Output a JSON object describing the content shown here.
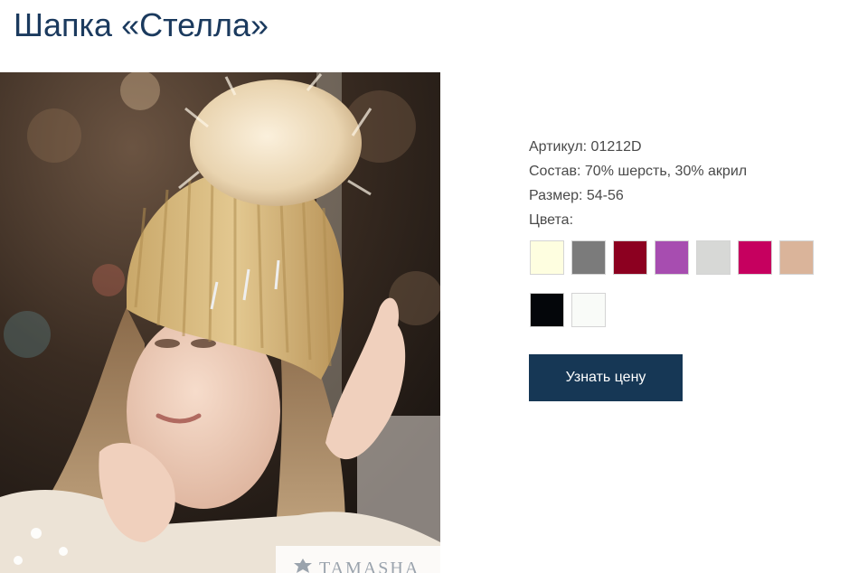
{
  "product": {
    "title": "Шапка «Стелла»",
    "article": "Артикул: 01212D",
    "composition": "Состав: 70% шерсть, 30% акрил",
    "size": "Размер: 54-56",
    "colors_label": "Цвета:"
  },
  "colors": [
    {
      "name": "cream",
      "hex": "#fefee0"
    },
    {
      "name": "gray",
      "hex": "#7b7b7b"
    },
    {
      "name": "burgundy",
      "hex": "#8c0020"
    },
    {
      "name": "violet",
      "hex": "#a74db0"
    },
    {
      "name": "light-gray",
      "hex": "#d7d8d6"
    },
    {
      "name": "raspberry",
      "hex": "#c6005f"
    },
    {
      "name": "beige",
      "hex": "#dab49a"
    },
    {
      "name": "black",
      "hex": "#04060a"
    },
    {
      "name": "white",
      "hex": "#f9fbf8"
    }
  ],
  "cta": {
    "label": "Узнать цену"
  },
  "photo": {
    "watermark": "TAMASHA",
    "icon": "tamasha-logo-icon"
  },
  "theme": {
    "title_color": "#1b3a5e",
    "button_color": "#163755"
  }
}
